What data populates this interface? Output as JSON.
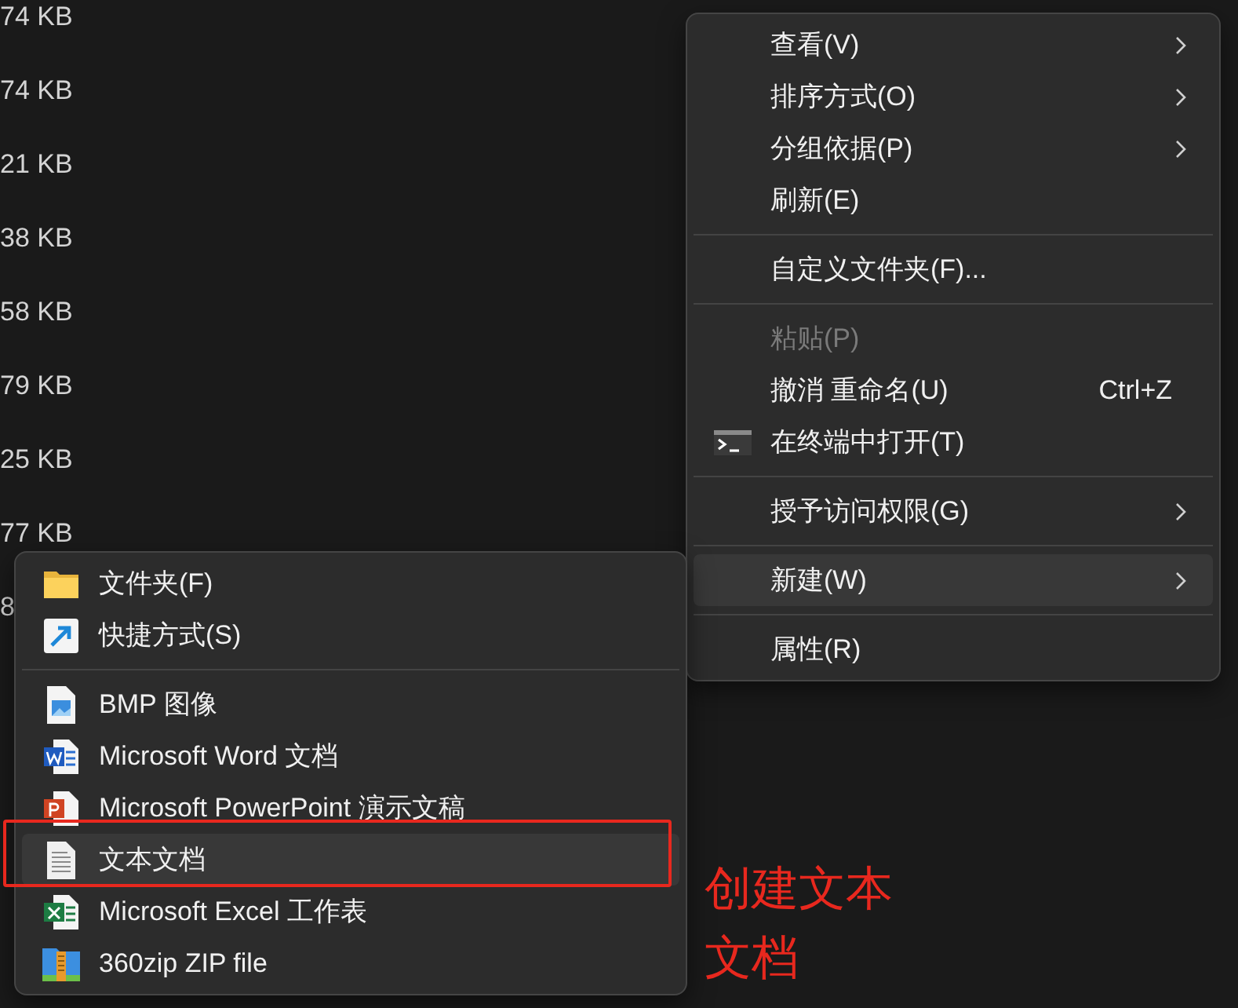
{
  "file_sizes": [
    "74 KB",
    "74 KB",
    "21 KB",
    "38 KB",
    "58 KB",
    "79 KB",
    "25 KB",
    "77 KB",
    "8"
  ],
  "context_menu": {
    "items": [
      {
        "kind": "item",
        "label": "查看(V)",
        "submenu": true,
        "disabled": false,
        "selected": false
      },
      {
        "kind": "item",
        "label": "排序方式(O)",
        "submenu": true,
        "disabled": false,
        "selected": false
      },
      {
        "kind": "item",
        "label": "分组依据(P)",
        "submenu": true,
        "disabled": false,
        "selected": false
      },
      {
        "kind": "item",
        "label": "刷新(E)",
        "submenu": false,
        "disabled": false,
        "selected": false
      },
      {
        "kind": "separator"
      },
      {
        "kind": "item",
        "label": "自定义文件夹(F)...",
        "submenu": false,
        "disabled": false,
        "selected": false
      },
      {
        "kind": "separator"
      },
      {
        "kind": "item",
        "label": "粘贴(P)",
        "submenu": false,
        "disabled": true,
        "selected": false
      },
      {
        "kind": "item",
        "label": "撤消 重命名(U)",
        "shortcut": "Ctrl+Z",
        "submenu": false,
        "disabled": false,
        "selected": false
      },
      {
        "kind": "item",
        "label": "在终端中打开(T)",
        "submenu": false,
        "disabled": false,
        "selected": false
      },
      {
        "kind": "separator"
      },
      {
        "kind": "item",
        "label": "授予访问权限(G)",
        "submenu": true,
        "disabled": false,
        "selected": false
      },
      {
        "kind": "separator"
      },
      {
        "kind": "item",
        "label": "新建(W)",
        "submenu": true,
        "disabled": false,
        "selected": true
      },
      {
        "kind": "separator"
      },
      {
        "kind": "item",
        "label": "属性(R)",
        "submenu": false,
        "disabled": false,
        "selected": false
      }
    ]
  },
  "new_submenu": {
    "items": [
      {
        "kind": "item",
        "label": "文件夹(F)",
        "selected": false
      },
      {
        "kind": "item",
        "label": "快捷方式(S)",
        "selected": false
      },
      {
        "kind": "separator"
      },
      {
        "kind": "item",
        "label": "BMP 图像",
        "selected": false
      },
      {
        "kind": "item",
        "label": "Microsoft Word 文档",
        "selected": false
      },
      {
        "kind": "item",
        "label": "Microsoft PowerPoint 演示文稿",
        "selected": false
      },
      {
        "kind": "item",
        "label": "文本文档",
        "selected": true
      },
      {
        "kind": "item",
        "label": "Microsoft Excel 工作表",
        "selected": false
      },
      {
        "kind": "item",
        "label": "360zip ZIP file",
        "selected": false
      }
    ]
  },
  "annotation": {
    "text": "创建文本文档",
    "color": "#e8281e"
  }
}
